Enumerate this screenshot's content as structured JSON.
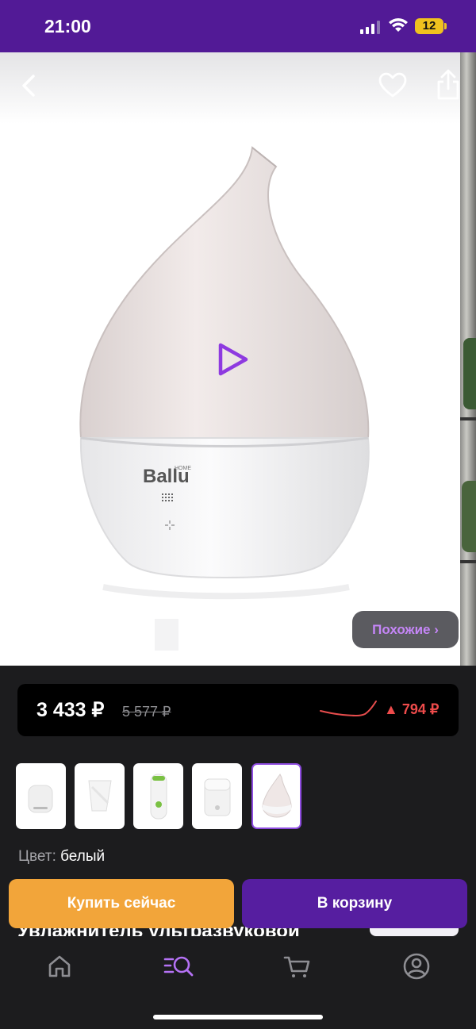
{
  "status_bar": {
    "time": "21:00",
    "battery": "12"
  },
  "product": {
    "similar_button": "Похожие ›",
    "image_brand": "Ballu",
    "image_brand_sub": "HOME"
  },
  "price": {
    "current": "3 433 ₽",
    "old": "5 577 ₽",
    "delta": "▲ 794 ₽"
  },
  "colors": {
    "accent": "#521a96",
    "buy": "#f2a53a",
    "cart": "#561ea0",
    "price_delta": "#ee4b4b"
  },
  "variant": {
    "label": "Цвет:",
    "value": "белый",
    "thumbnails": [
      "thumb-round-white",
      "thumb-cone-clear",
      "thumb-tower-green",
      "thumb-cube-white",
      "thumb-drop-white"
    ],
    "selected_index": 4
  },
  "actions": {
    "buy_now": "Купить сейчас",
    "add_to_cart": "В корзину"
  },
  "product_title_partial": "Увлажнитель ультразвуковой",
  "tab_bar": {
    "items": [
      "home-icon",
      "catalog-search-icon",
      "cart-icon",
      "profile-icon"
    ],
    "active": "catalog-search-icon"
  }
}
